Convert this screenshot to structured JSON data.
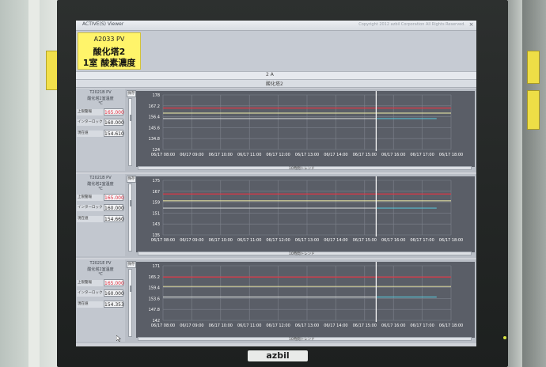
{
  "window": {
    "title": "ACTIVE(S) Viewer",
    "copyright": "Copyright 2012 azbil Corporation All Rights Reserved.",
    "close_label": "×"
  },
  "header": {
    "tag_code": "A2033 PV",
    "name_line1": "酸化塔2",
    "name_line2": "1室 酸素濃度"
  },
  "tab": {
    "label": "2 A"
  },
  "group": {
    "label": "酸化塔2"
  },
  "panels": [
    {
      "tag": "T2021B PV",
      "subtitle": "酸化塔2室温度",
      "unit": "℃",
      "rows": [
        {
          "label": "上限警報",
          "value": "165.000",
          "alarm": true
        },
        {
          "label": "インターロック",
          "value": "160.000",
          "alarm": false
        },
        {
          "label": "現在値",
          "value": "154.610",
          "alarm": false
        }
      ],
      "save_label": "保存",
      "trend_label": "10時間トレンド"
    },
    {
      "tag": "T2021B PV",
      "subtitle": "酸化塔2室温度",
      "unit": "℃",
      "rows": [
        {
          "label": "上限警報",
          "value": "165.000",
          "alarm": true
        },
        {
          "label": "インターロック",
          "value": "160.000",
          "alarm": false
        },
        {
          "label": "現在値",
          "value": "154.660",
          "alarm": false
        }
      ],
      "save_label": "保存",
      "trend_label": "10時間トレンド"
    },
    {
      "tag": "T2021E PV",
      "subtitle": "酸化塔2室温度",
      "unit": "℃",
      "rows": [
        {
          "label": "上限警報",
          "value": "165.000",
          "alarm": true
        },
        {
          "label": "インターロック",
          "value": "160.000",
          "alarm": false
        },
        {
          "label": "現在値",
          "value": "154.353",
          "alarm": false
        }
      ],
      "save_label": "保存",
      "trend_label": "10時間トレンド"
    }
  ],
  "colors": {
    "plot_bg": "#5a5e67",
    "grid": "#7d828c",
    "alarm_line": "#e23644",
    "interlock_line": "#f3f0a8",
    "pv_line": "#e9ece9",
    "recent_line": "#58d6e8",
    "now_line": "#ffffff"
  },
  "chart_data": [
    {
      "type": "line",
      "x": [
        "06/17 08:00",
        "06/17 09:00",
        "06/17 10:00",
        "06/17 11:00",
        "06/17 12:00",
        "06/17 13:00",
        "06/17 14:00",
        "06/17 15:00",
        "06/17 16:00",
        "06/17 17:00",
        "06/17 18:00"
      ],
      "y_ticks": [
        "178",
        "167.2",
        "156.4",
        "145.6",
        "134.8",
        "124"
      ],
      "ylim": [
        124,
        178
      ],
      "series": [
        {
          "name": "上限警報",
          "color": "#e23644",
          "values": [
            165,
            165
          ]
        },
        {
          "name": "インターロック",
          "color": "#f3f0a8",
          "values": [
            160,
            160
          ]
        },
        {
          "name": "現在値",
          "color": "#e9ece9",
          "values": [
            154.6,
            154.6
          ]
        }
      ],
      "now_x": 7.4,
      "recent_span": [
        7.4,
        9.5
      ]
    },
    {
      "type": "line",
      "x": [
        "06/17 08:00",
        "06/17 09:00",
        "06/17 10:00",
        "06/17 11:00",
        "06/17 12:00",
        "06/17 13:00",
        "06/17 14:00",
        "06/17 15:00",
        "06/17 16:00",
        "06/17 17:00",
        "06/17 18:00"
      ],
      "y_ticks": [
        "175",
        "167",
        "159",
        "151",
        "143",
        "135"
      ],
      "ylim": [
        135,
        175
      ],
      "series": [
        {
          "name": "上限警報",
          "color": "#e23644",
          "values": [
            165,
            165
          ]
        },
        {
          "name": "インターロック",
          "color": "#f3f0a8",
          "values": [
            160,
            160
          ]
        },
        {
          "name": "現在値",
          "color": "#e9ece9",
          "values": [
            154.7,
            154.7
          ]
        }
      ],
      "now_x": 7.4,
      "recent_span": [
        7.4,
        9.5
      ]
    },
    {
      "type": "line",
      "x": [
        "06/17 08:00",
        "06/17 09:00",
        "06/17 10:00",
        "06/17 11:00",
        "06/17 12:00",
        "06/17 13:00",
        "06/17 14:00",
        "06/17 15:00",
        "06/17 16:00",
        "06/17 17:00",
        "06/17 18:00"
      ],
      "y_ticks": [
        "171",
        "165.2",
        "159.4",
        "153.6",
        "147.8",
        "142"
      ],
      "ylim": [
        142,
        171
      ],
      "series": [
        {
          "name": "上限警報",
          "color": "#e23644",
          "values": [
            165,
            165
          ]
        },
        {
          "name": "インターロック",
          "color": "#f3f0a8",
          "values": [
            160,
            160
          ]
        },
        {
          "name": "現在値",
          "color": "#e9ece9",
          "values": [
            154.4,
            154.4
          ]
        }
      ],
      "now_x": 7.4,
      "recent_span": [
        7.4,
        9.5
      ]
    }
  ]
}
